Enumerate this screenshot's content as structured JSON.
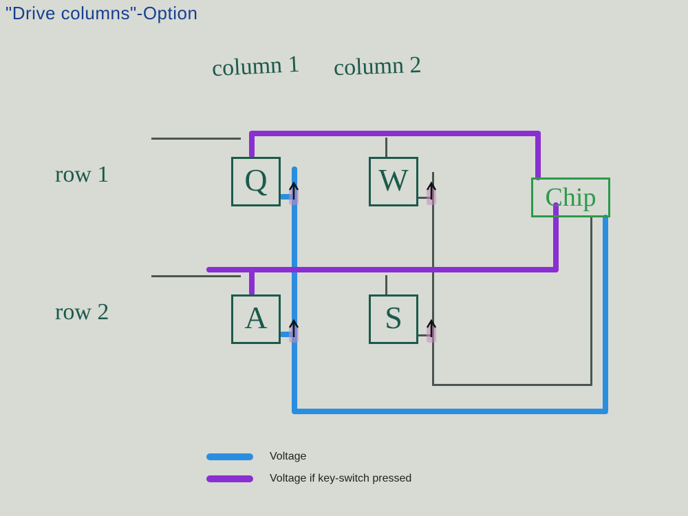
{
  "title": "\"Drive columns\"-Option",
  "columns": {
    "col1": "column 1",
    "col2": "column 2"
  },
  "rows": {
    "row1": "row 1",
    "row2": "row 2"
  },
  "keys": {
    "q": "Q",
    "w": "W",
    "a": "A",
    "s": "S"
  },
  "chip": "Chip",
  "legend": {
    "voltage": "Voltage",
    "voltage_pressed": "Voltage if key-switch pressed"
  },
  "colors": {
    "voltage": "#2a8ee0",
    "voltage_pressed": "#8a2fd1",
    "wire": "#4a5550",
    "ink": "#1b5a4b",
    "chip_border": "#2a9a4a",
    "title": "#16408f",
    "diode": "#c98bbd"
  },
  "chart_data": {
    "type": "table",
    "description": "2×2 keyboard matrix scanned by driving columns. Chip drives a column line (blue = voltage). If a key on that column is pressed, the corresponding row line goes high (purple). Diodes on each switch point from column line toward key (into the row line).",
    "columns": [
      "column 1",
      "column 2"
    ],
    "rows": [
      "row 1",
      "row 2"
    ],
    "cells": [
      {
        "row": "row 1",
        "col": "column 1",
        "key": "Q"
      },
      {
        "row": "row 1",
        "col": "column 2",
        "key": "W"
      },
      {
        "row": "row 2",
        "col": "column 1",
        "key": "A"
      },
      {
        "row": "row 2",
        "col": "column 2",
        "key": "S"
      }
    ],
    "driven_column": "column 1",
    "legend": {
      "blue": "Voltage (column being driven by chip)",
      "purple": "Voltage on row line if a key-switch on the driven column is pressed"
    }
  }
}
